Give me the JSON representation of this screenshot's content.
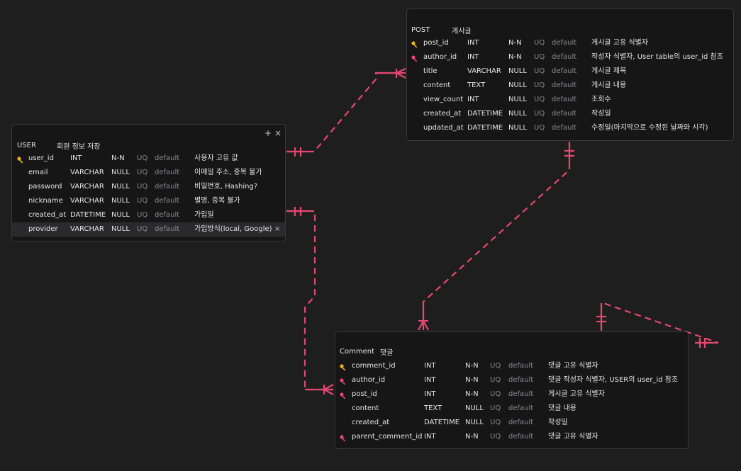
{
  "colors": {
    "background": "#1e1e1f",
    "table_bg": "#161617",
    "relation": "#e3486f",
    "primary_key": "#e6b422",
    "foreign_key": "#e3486f"
  },
  "tables": {
    "post": {
      "name": "POST",
      "comment": "게시글",
      "columns": [
        {
          "name": "post_id",
          "type": "INT",
          "nullable": "N-N",
          "uq": "UQ",
          "default": "default",
          "comment": "게시글 고유 식별자",
          "key": "primary"
        },
        {
          "name": "author_id",
          "type": "INT",
          "nullable": "N-N",
          "uq": "UQ",
          "default": "default",
          "comment": "작성자 식별자, User table의 user_id 참조",
          "key": "foreign"
        },
        {
          "name": "title",
          "type": "VARCHAR",
          "nullable": "NULL",
          "uq": "UQ",
          "default": "default",
          "comment": "게시글 제목",
          "key": ""
        },
        {
          "name": "content",
          "type": "TEXT",
          "nullable": "NULL",
          "uq": "UQ",
          "default": "default",
          "comment": "게시글 내용",
          "key": ""
        },
        {
          "name": "view_count",
          "type": "INT",
          "nullable": "NULL",
          "uq": "UQ",
          "default": "default",
          "comment": "조회수",
          "key": ""
        },
        {
          "name": "created_at",
          "type": "DATETIME",
          "nullable": "NULL",
          "uq": "UQ",
          "default": "default",
          "comment": "작성일",
          "key": ""
        },
        {
          "name": "updated_at",
          "type": "DATETIME",
          "nullable": "NULL",
          "uq": "UQ",
          "default": "default",
          "comment": "수정일(마지막으로 수정된 날짜와 시각)",
          "key": ""
        }
      ]
    },
    "user": {
      "name": "USER",
      "comment": "회원 정보 저장",
      "add_icon": "+",
      "close_icon": "×",
      "row_delete_icon": "×",
      "columns": [
        {
          "name": "user_id",
          "type": "INT",
          "nullable": "N-N",
          "uq": "UQ",
          "default": "default",
          "comment": "사용자 고유 값",
          "key": "primary"
        },
        {
          "name": "email",
          "type": "VARCHAR",
          "nullable": "NULL",
          "uq": "UQ",
          "default": "default",
          "comment": "이메일 주소, 중복 불가",
          "key": ""
        },
        {
          "name": "password",
          "type": "VARCHAR",
          "nullable": "NULL",
          "uq": "UQ",
          "default": "default",
          "comment": "비밀번호, Hashing?",
          "key": ""
        },
        {
          "name": "nickname",
          "type": "VARCHAR",
          "nullable": "NULL",
          "uq": "UQ",
          "default": "default",
          "comment": "별명, 중복 불가",
          "key": ""
        },
        {
          "name": "created_at",
          "type": "DATETIME",
          "nullable": "NULL",
          "uq": "UQ",
          "default": "default",
          "comment": "가입일",
          "key": ""
        },
        {
          "name": "provider",
          "type": "VARCHAR",
          "nullable": "NULL",
          "uq": "UQ",
          "default": "default",
          "comment": "가입방식(local, Google)",
          "key": ""
        }
      ]
    },
    "comment": {
      "name": "Comment",
      "comment": "댓글",
      "columns": [
        {
          "name": "comment_id",
          "type": "INT",
          "nullable": "N-N",
          "uq": "UQ",
          "default": "default",
          "comment": "댓글 고유 식별자",
          "key": "primary"
        },
        {
          "name": "author_id",
          "type": "INT",
          "nullable": "N-N",
          "uq": "UQ",
          "default": "default",
          "comment": "댓글 작성자 식별자, USER의 user_id 참조",
          "key": "foreign"
        },
        {
          "name": "post_id",
          "type": "INT",
          "nullable": "N-N",
          "uq": "UQ",
          "default": "default",
          "comment": "게시글 고유 식별자",
          "key": "foreign"
        },
        {
          "name": "content",
          "type": "TEXT",
          "nullable": "NULL",
          "uq": "UQ",
          "default": "default",
          "comment": "댓글 내용",
          "key": ""
        },
        {
          "name": "created_at",
          "type": "DATETIME",
          "nullable": "NULL",
          "uq": "UQ",
          "default": "default",
          "comment": "작성일",
          "key": ""
        },
        {
          "name": "parent_comment_id",
          "type": "INT",
          "nullable": "N-N",
          "uq": "UQ",
          "default": "default",
          "comment": "댓글 고유 식별자",
          "key": "foreign"
        }
      ]
    }
  },
  "relations": [
    {
      "name": "user-to-post",
      "from": "USER.user_id",
      "to": "POST.author_id",
      "from_cardinality": "one-only",
      "to_cardinality": "one-or-many"
    },
    {
      "name": "user-to-comment",
      "from": "USER.user_id",
      "to": "Comment.author_id",
      "from_cardinality": "one-only",
      "to_cardinality": "one-or-many"
    },
    {
      "name": "post-to-comment",
      "from": "POST.post_id",
      "to": "Comment.post_id",
      "from_cardinality": "one-only",
      "to_cardinality": "one-or-many"
    },
    {
      "name": "comment-self-reference",
      "from": "Comment.comment_id",
      "to": "Comment.parent_comment_id",
      "from_cardinality": "one-only",
      "to_cardinality": "one-only"
    }
  ]
}
